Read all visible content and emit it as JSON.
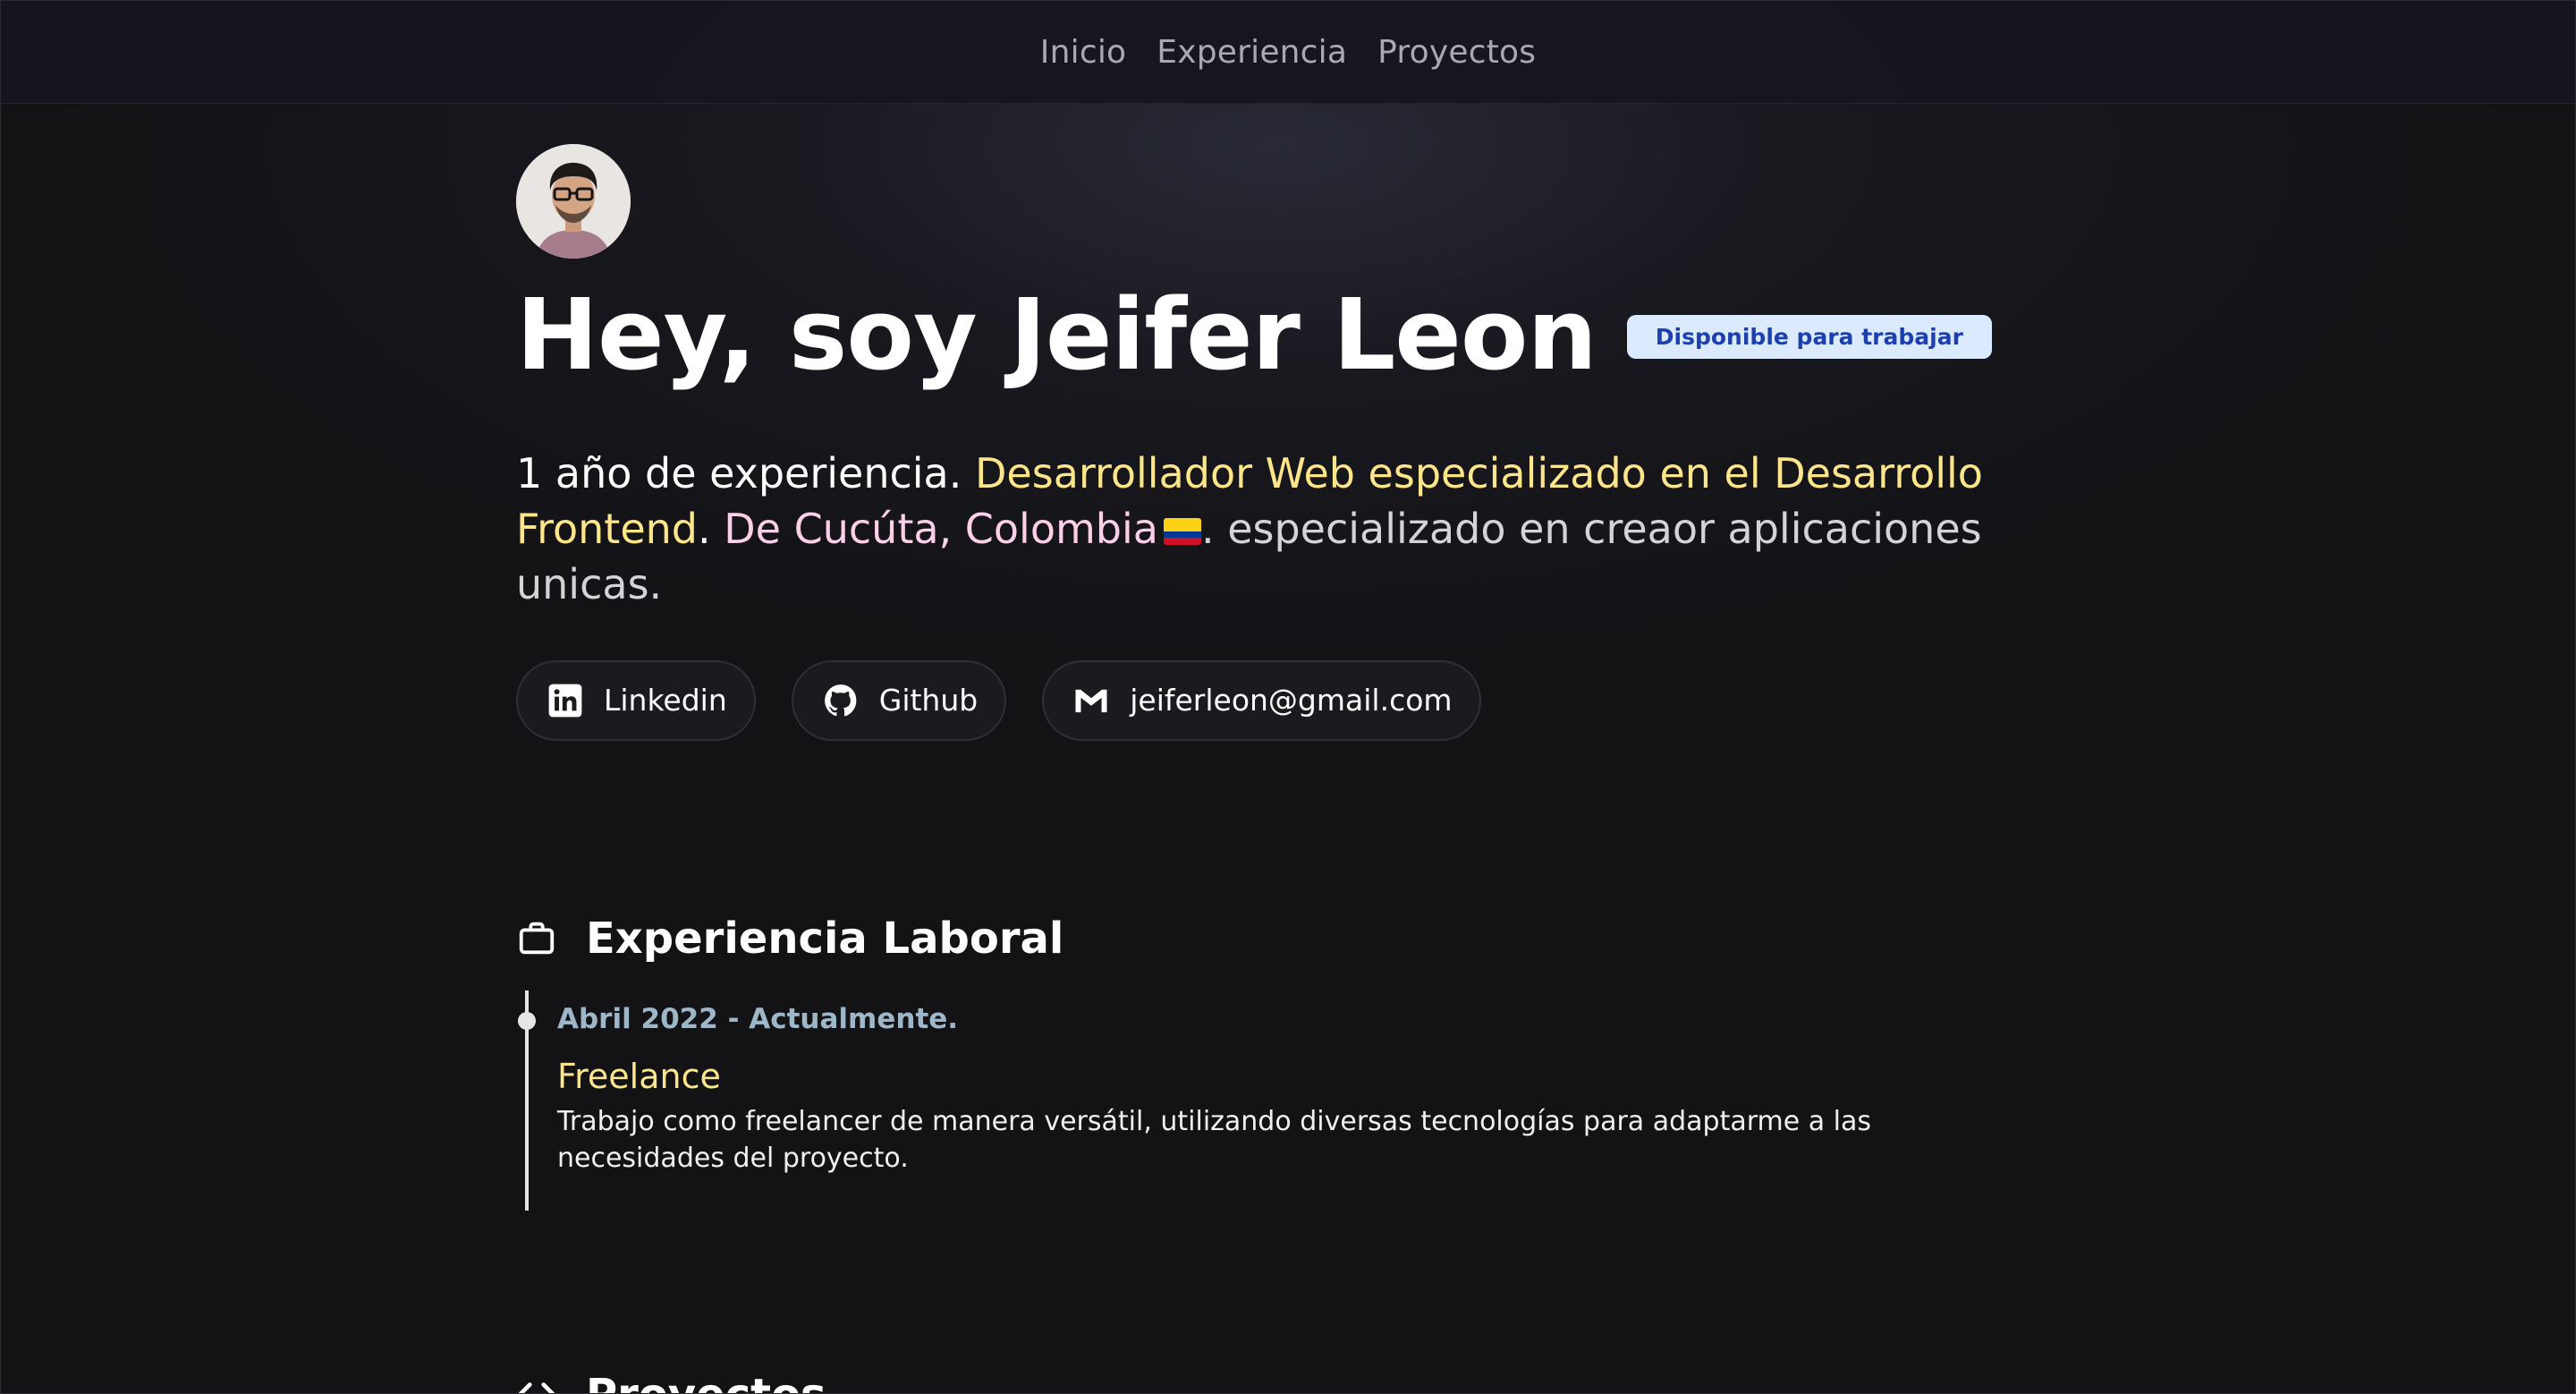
{
  "nav": {
    "items": [
      {
        "label": "Inicio"
      },
      {
        "label": "Experiencia"
      },
      {
        "label": "Proyectos"
      }
    ]
  },
  "hero": {
    "avatar_icon": "profile-photo",
    "title": "Hey, soy Jeifer Leon",
    "badge": "Disponible para trabajar",
    "intro": {
      "lead": "1 año de experiencia.",
      "role": "Desarrollador Web especializado en el Desarrollo Frontend",
      "period": ".",
      "location": "De Cucúta, Colombia",
      "flag_icon": "colombia-flag",
      "rest": ". especializado en creaor aplicaciones unicas."
    },
    "contacts": [
      {
        "label": "Linkedin",
        "icon": "linkedin-icon"
      },
      {
        "label": "Github",
        "icon": "github-icon"
      },
      {
        "label": "jeiferleon@gmail.com",
        "icon": "gmail-icon"
      }
    ]
  },
  "experience": {
    "title": "Experiencia Laboral",
    "icon": "briefcase-icon",
    "items": [
      {
        "date": "Abril 2022 - Actualmente.",
        "role": "Freelance",
        "description": "Trabajo como freelancer de manera versátil, utilizando diversas tecnologías para adaptarme a las necesidades del proyecto."
      }
    ]
  },
  "projects": {
    "title": "Proyectos",
    "icon": "code-icon"
  },
  "colors": {
    "background": "#131316",
    "accent_yellow": "#fde68a",
    "accent_pink": "#fbcfe8",
    "badge_bg": "#dbeafe",
    "badge_text": "#1e40af",
    "date_text": "#9db7c8"
  }
}
